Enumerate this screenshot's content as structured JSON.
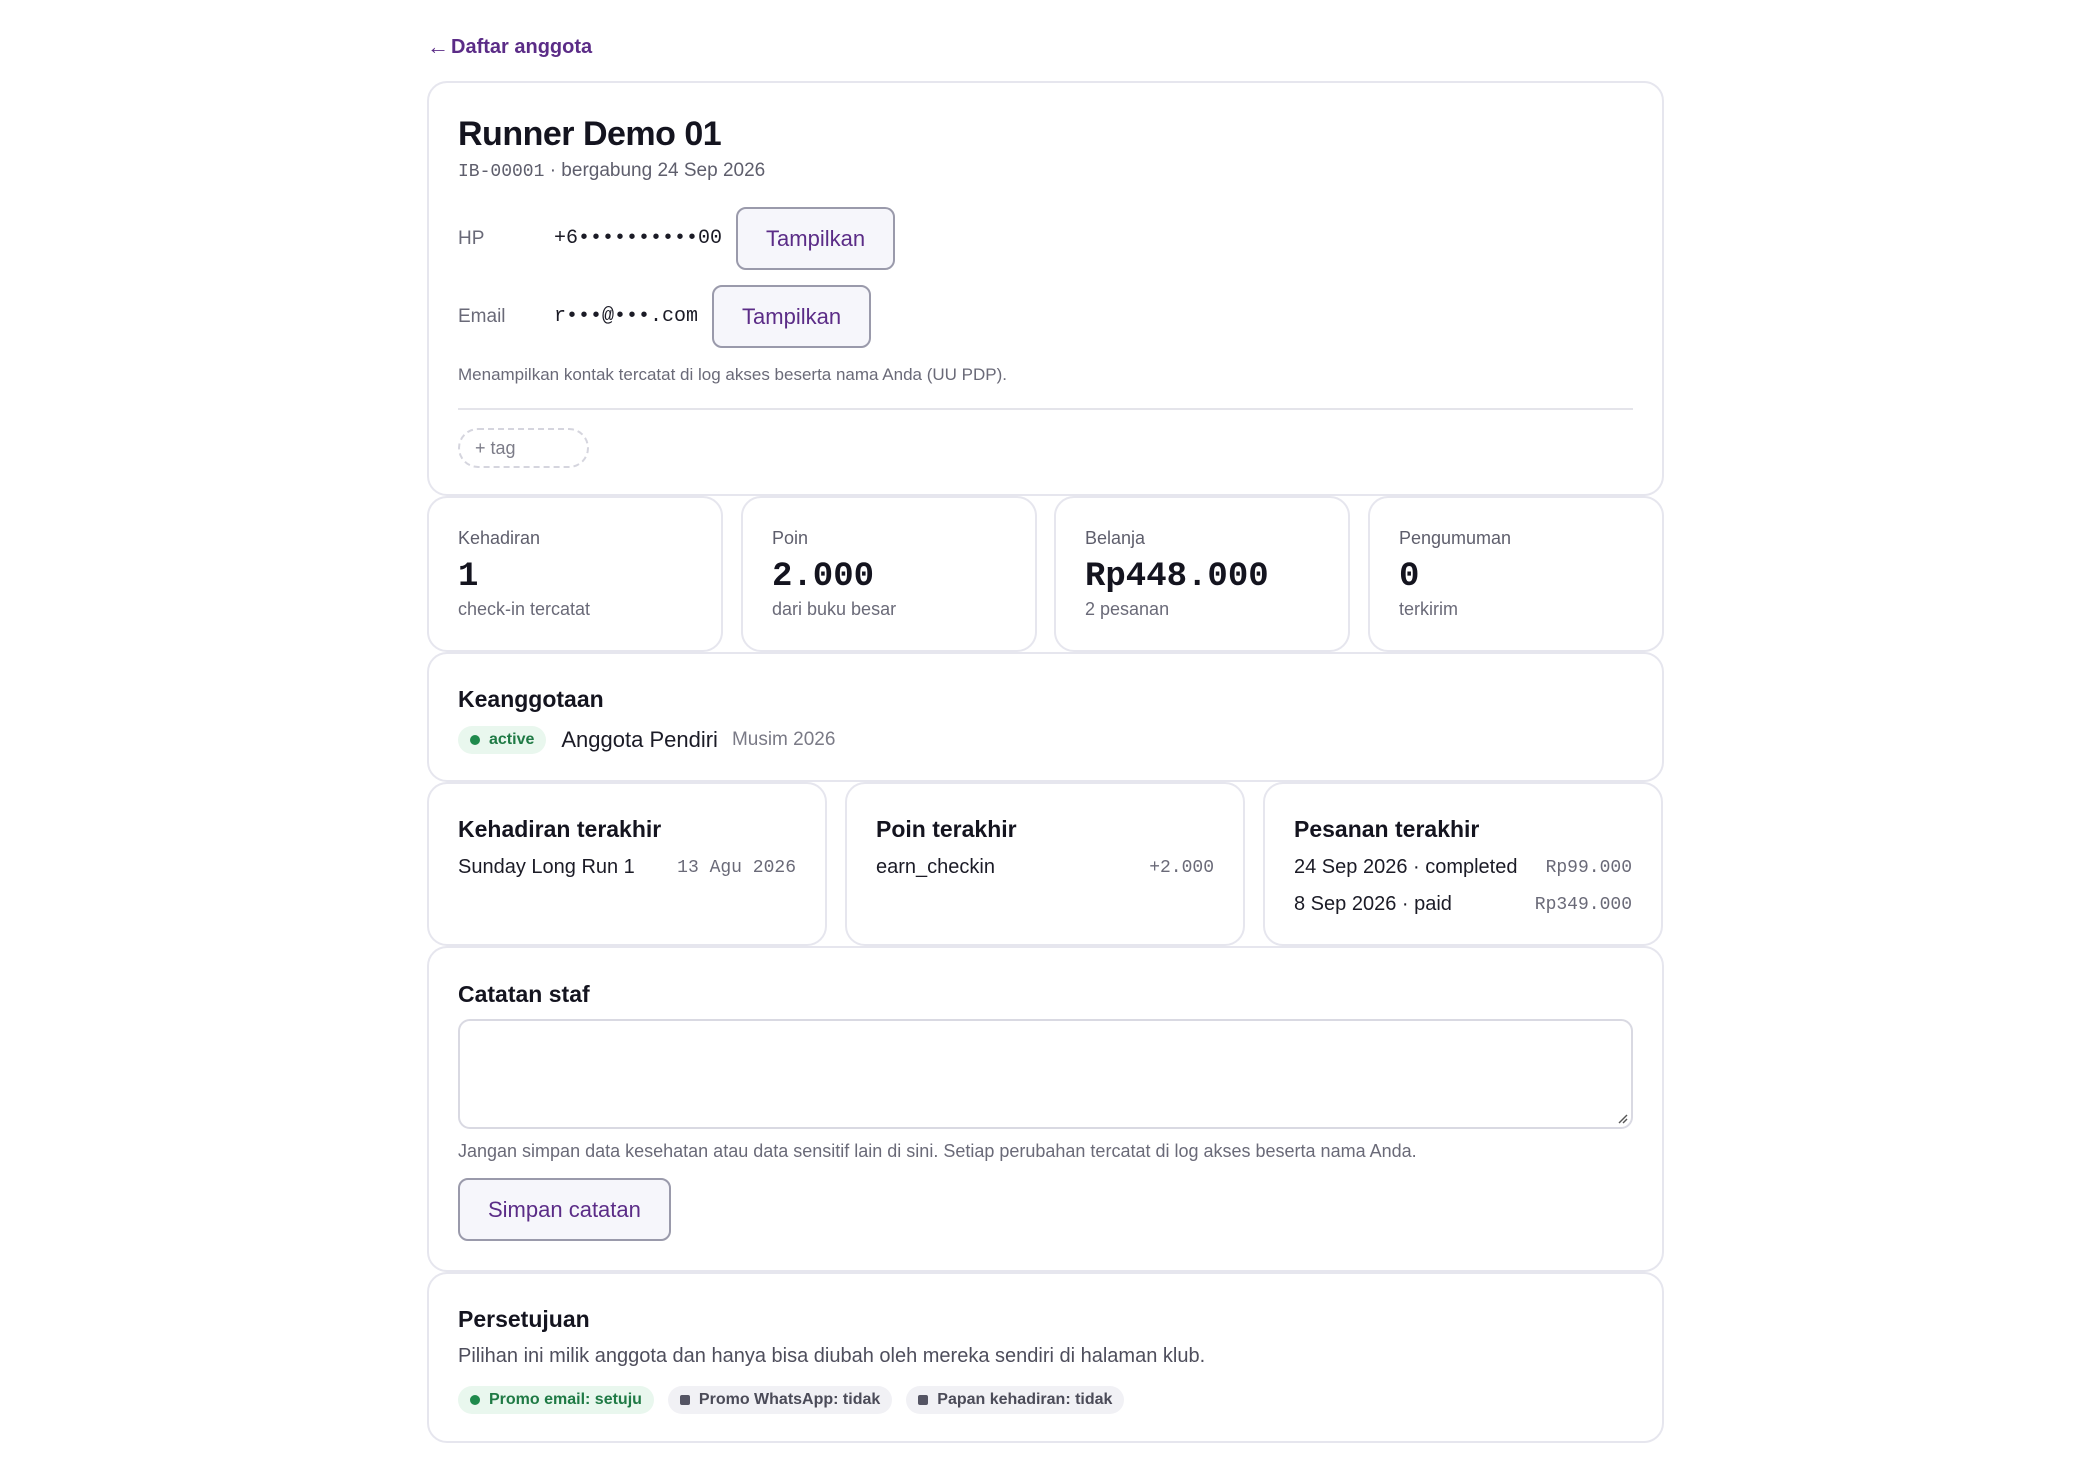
{
  "nav": {
    "back_arrow": "←",
    "back_label": "Daftar anggota"
  },
  "member": {
    "name": "Runner Demo 01",
    "id": "IB-00001",
    "joined": "· bergabung 24 Sep 2026",
    "phone_label": "HP",
    "phone_value": "+6••••••••••00",
    "email_label": "Email",
    "email_value": "r•••@•••.com",
    "reveal_label": "Tampilkan",
    "reveal_note": "Menampilkan kontak tercatat di log akses beserta nama Anda (UU PDP).",
    "add_tag_label": "+ tag"
  },
  "stats": [
    {
      "label": "Kehadiran",
      "value": "1",
      "sub": "check-in tercatat"
    },
    {
      "label": "Poin",
      "value": "2.000",
      "sub": "dari buku besar"
    },
    {
      "label": "Belanja",
      "value": "Rp448.000",
      "sub": "2 pesanan"
    },
    {
      "label": "Pengumuman",
      "value": "0",
      "sub": "terkirim"
    }
  ],
  "membership": {
    "title": "Keanggotaan",
    "status": "active",
    "tier": "Anggota Pendiri",
    "season": "Musim 2026"
  },
  "recent_attendance": {
    "title": "Kehadiran terakhir",
    "items": [
      {
        "name": "Sunday Long Run 1",
        "date": "13 Agu 2026"
      }
    ]
  },
  "recent_points": {
    "title": "Poin terakhir",
    "items": [
      {
        "reason": "earn_checkin",
        "amount": "+2.000"
      }
    ]
  },
  "recent_orders": {
    "title": "Pesanan terakhir",
    "items": [
      {
        "desc": "24 Sep 2026 · completed",
        "amount": "Rp99.000"
      },
      {
        "desc": "8 Sep 2026 · paid",
        "amount": "Rp349.000"
      }
    ]
  },
  "notes": {
    "title": "Catatan staf",
    "value": "",
    "help": "Jangan simpan data kesehatan atau data sensitif lain di sini. Setiap perubahan tercatat di log akses beserta nama Anda.",
    "save_label": "Simpan catatan"
  },
  "consent": {
    "title": "Persetujuan",
    "desc": "Pilihan ini milik anggota dan hanya bisa diubah oleh mereka sendiri di halaman klub.",
    "items": [
      {
        "label": "Promo email: setuju",
        "state": "yes"
      },
      {
        "label": "Promo WhatsApp: tidak",
        "state": "no"
      },
      {
        "label": "Papan kehadiran: tidak",
        "state": "no"
      }
    ]
  },
  "colors": {
    "accent": "#5b2c87",
    "border": "#e6e6ee",
    "success": "#1f8a4c",
    "success_bg": "#e9f7ee",
    "neutral_bg": "#f1f1f5"
  }
}
